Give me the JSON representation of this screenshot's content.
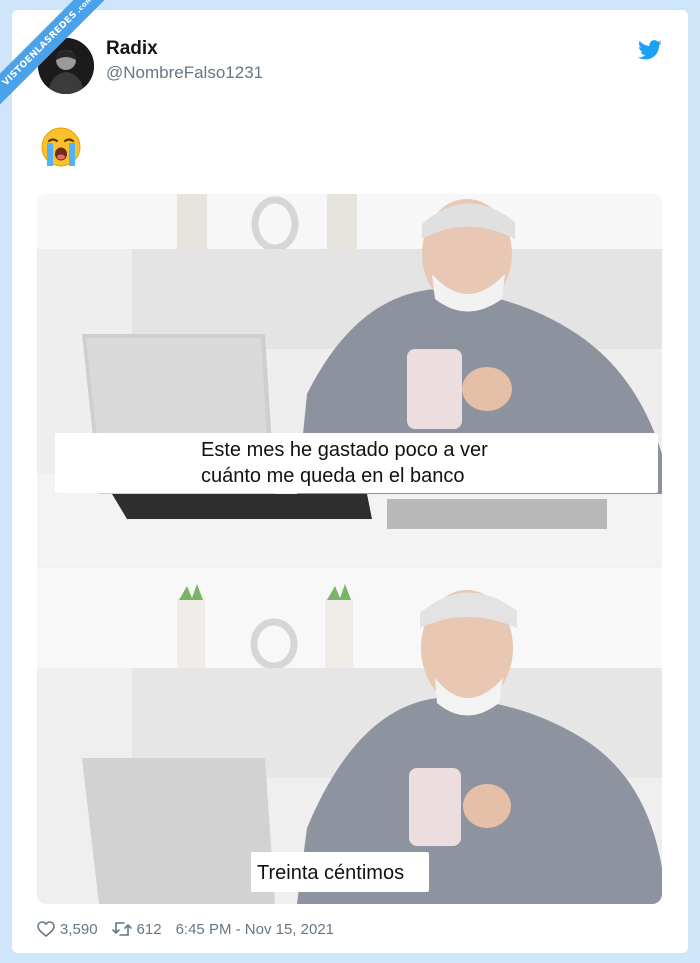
{
  "ribbon": {
    "text": "VISTOENLASREDES",
    "suffix": ".com"
  },
  "tweet": {
    "display_name": "Radix",
    "handle": "@NombreFalso1231",
    "emoji_icon": "loudly-crying-face-icon",
    "brand_icon": "twitter-bird-icon",
    "brand_color": "#1da1f2"
  },
  "meme": {
    "top_caption_line1": "Este mes he gastado poco a ver",
    "top_caption_line2": "cuánto me queda en el banco",
    "bottom_caption": "Treinta céntimos"
  },
  "footer": {
    "likes": "3,590",
    "retweets": "612",
    "timestamp": "6:45 PM - Nov 15, 2021",
    "like_icon": "heart-icon",
    "retweet_icon": "retweet-icon"
  }
}
